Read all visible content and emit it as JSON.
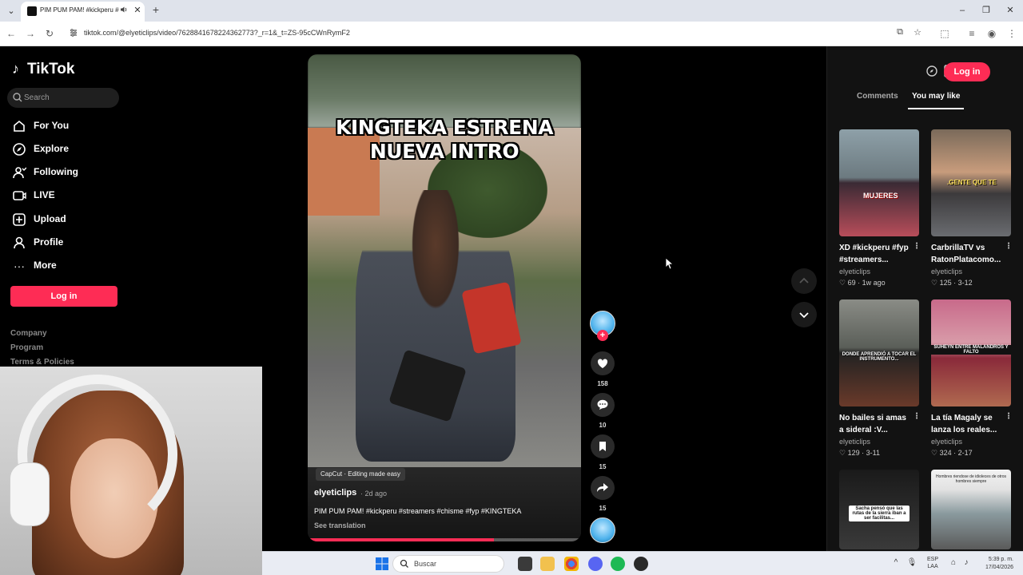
{
  "browser": {
    "tab_title": "PIM PUM PAM! #kickperu #",
    "url": "tiktok.com/@elyeticlips/video/7628841678224362773?_r=1&_t=ZS-95cCWnRymF2",
    "new_tab": "+",
    "tab_close": "✕"
  },
  "sidebar": {
    "logo": "TikTok",
    "search_placeholder": "Search",
    "items": [
      {
        "label": "For You",
        "icon": "home-icon"
      },
      {
        "label": "Explore",
        "icon": "compass-icon"
      },
      {
        "label": "Following",
        "icon": "following-icon"
      },
      {
        "label": "LIVE",
        "icon": "live-icon"
      },
      {
        "label": "Upload",
        "icon": "upload-icon"
      },
      {
        "label": "Profile",
        "icon": "profile-icon"
      },
      {
        "label": "More",
        "icon": "more-icon"
      }
    ],
    "login": "Log in",
    "footer": [
      "Company",
      "Program",
      "Terms & Policies"
    ]
  },
  "video": {
    "caption_line1": "KINGTEKA ESTRENA",
    "caption_line2": "NUEVA INTRO",
    "capcut_label": "CapCut · Editing made easy",
    "username": "elyeticlips",
    "date": "· 2d ago",
    "description": "PIM PUM PAM! #kickperu #streamers #chisme #fyp #KINGTEKA",
    "see_translation": "See translation",
    "progress": 0.68
  },
  "actions": {
    "likes": "158",
    "comments": "10",
    "saves": "15",
    "shares": "15"
  },
  "right_panel": {
    "login": "Log in",
    "tabs": [
      "Comments",
      "You may like"
    ],
    "active_tab": "You may like",
    "cards": [
      {
        "title": "XD #kickperu #fyp #streamers...",
        "user": "elyeticlips",
        "likes": "69",
        "age": "1w ago",
        "overlay": "MUJERES"
      },
      {
        "title": "CarbrillaTV vs RatonPlatacomo...",
        "user": "elyeticlips",
        "likes": "125",
        "age": "3-12",
        "overlay": ".GENTE QUE TE"
      },
      {
        "title": "No bailes si amas a sideral :V...",
        "user": "elyeticlips",
        "likes": "129",
        "age": "3-11",
        "overlay": "DONDE APRENDIÓ A TOCAR EL INSTRUMENTO..."
      },
      {
        "title": "La tía Magaly se lanza los reales...",
        "user": "elyeticlips",
        "likes": "324",
        "age": "2-17",
        "overlay": "SUHEYN ENTRE MALANDROS Y FALTO"
      },
      {
        "overlay": "Sacha pensó que las rutas de la sierra iban a ser facilitas..."
      },
      {
        "overlay": "Hombres riendose de idioleces de otros hombres siempre"
      }
    ]
  },
  "taskbar": {
    "search": "Buscar",
    "lang_top": "ESP",
    "lang_bottom": "LAA",
    "time": "5:39 p. m.",
    "date": "17/04/2026"
  },
  "colors": {
    "accent": "#fe2c55",
    "background": "#000000",
    "panel": "#121212"
  }
}
